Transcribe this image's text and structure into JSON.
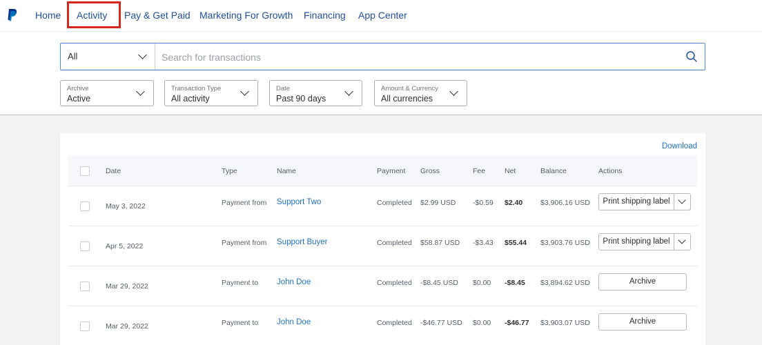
{
  "nav": {
    "items": [
      "Home",
      "Activity",
      "Pay & Get Paid",
      "Marketing For Growth",
      "Financing",
      "App Center"
    ],
    "active": "Activity",
    "brand_color": "#003087",
    "highlight_color": "#d7261e"
  },
  "search": {
    "scope": "All",
    "placeholder": "Search for transactions",
    "value": ""
  },
  "filters": [
    {
      "label": "Archive",
      "value": "Active"
    },
    {
      "label": "Transaction Type",
      "value": "All activity"
    },
    {
      "label": "Date",
      "value": "Past 90 days"
    },
    {
      "label": "Amount & Currency",
      "value": "All currencies"
    }
  ],
  "table": {
    "download_label": "Download",
    "columns": [
      "Date",
      "Type",
      "Name",
      "Payment",
      "Gross",
      "Fee",
      "Net",
      "Balance",
      "Actions"
    ],
    "rows": [
      {
        "date": "May 3, 2022",
        "type": "Payment from",
        "name": "Support Two",
        "payment": "Completed",
        "gross": "$2.99 USD",
        "fee": "-$0.59",
        "net": "$2.40",
        "balance": "$3,906.16 USD",
        "action": "Print shipping label"
      },
      {
        "date": "Apr 5, 2022",
        "type": "Payment from",
        "name": "Support Buyer",
        "payment": "Completed",
        "gross": "$58.87 USD",
        "fee": "-$3.43",
        "net": "$55.44",
        "balance": "$3,903.76 USD",
        "action": "Print shipping label"
      },
      {
        "date": "Mar 29, 2022",
        "type": "Payment to",
        "name": "John Doe",
        "payment": "Completed",
        "gross": "-$8.45 USD",
        "fee": "$0.00",
        "net": "-$8.45",
        "balance": "$3,894.62 USD",
        "action": "Archive"
      },
      {
        "date": "Mar 29, 2022",
        "type": "Payment to",
        "name": "John Doe",
        "payment": "Completed",
        "gross": "-$46.77 USD",
        "fee": "$0.00",
        "net": "-$46.77",
        "balance": "$3,903.07 USD",
        "action": "Archive"
      }
    ]
  }
}
